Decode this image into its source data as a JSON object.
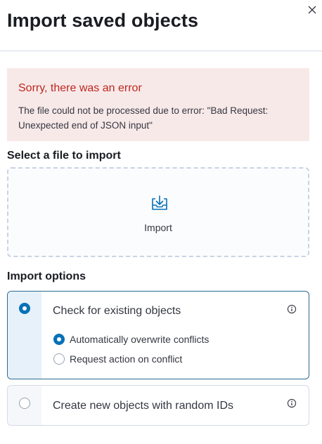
{
  "header": {
    "title": "Import saved objects",
    "close_icon": "close-icon"
  },
  "error": {
    "title": "Sorry, there was an error",
    "message": "The file could not be processed due to error: \"Bad Request: Unexpected end of JSON input\""
  },
  "file_picker": {
    "label": "Select a file to import",
    "button_label": "Import",
    "icon": "import-icon"
  },
  "import_options": {
    "label": "Import options",
    "options": [
      {
        "label": "Check for existing objects",
        "selected": true,
        "sub_options": [
          {
            "label": "Automatically overwrite conflicts",
            "selected": true
          },
          {
            "label": "Request action on conflict",
            "selected": false
          }
        ]
      },
      {
        "label": "Create new objects with random IDs",
        "selected": false
      }
    ]
  },
  "colors": {
    "accent": "#0771b8",
    "danger": "#bd271e",
    "danger_bg": "#f8e9e9"
  }
}
